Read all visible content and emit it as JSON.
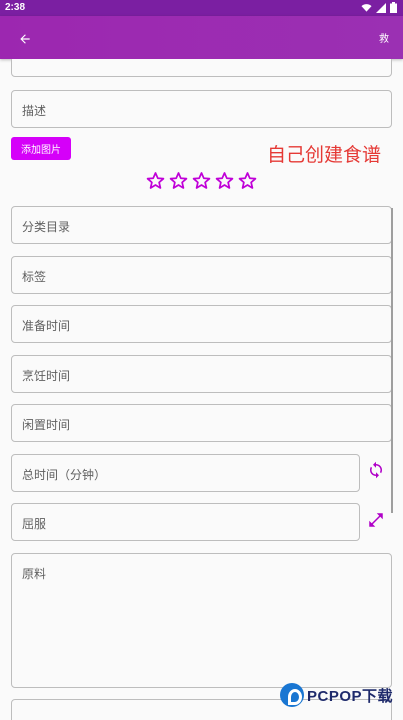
{
  "status_bar": {
    "time": "2:38",
    "icons": [
      "wifi-icon",
      "signal-icon",
      "battery-icon"
    ]
  },
  "app_bar": {
    "back_icon": "arrow-back-icon",
    "action_label": "救"
  },
  "form": {
    "description_label": "描述",
    "add_image_label": "添加图片",
    "headline": "自己创建食谱",
    "rating": {
      "max": 5,
      "value": 0
    },
    "category_label": "分类目录",
    "tags_label": "标签",
    "prep_time_label": "准备时间",
    "cook_time_label": "烹饪时间",
    "idle_time_label": "闲置时间",
    "total_time_label": "总时间（分钟）",
    "servings_label": "屈服",
    "ingredients_label": "原料"
  },
  "watermark": {
    "text": "PCPOP下载"
  },
  "colors": {
    "primary": "#9c27b0",
    "accent": "#d500f9",
    "headline": "#e53935"
  }
}
